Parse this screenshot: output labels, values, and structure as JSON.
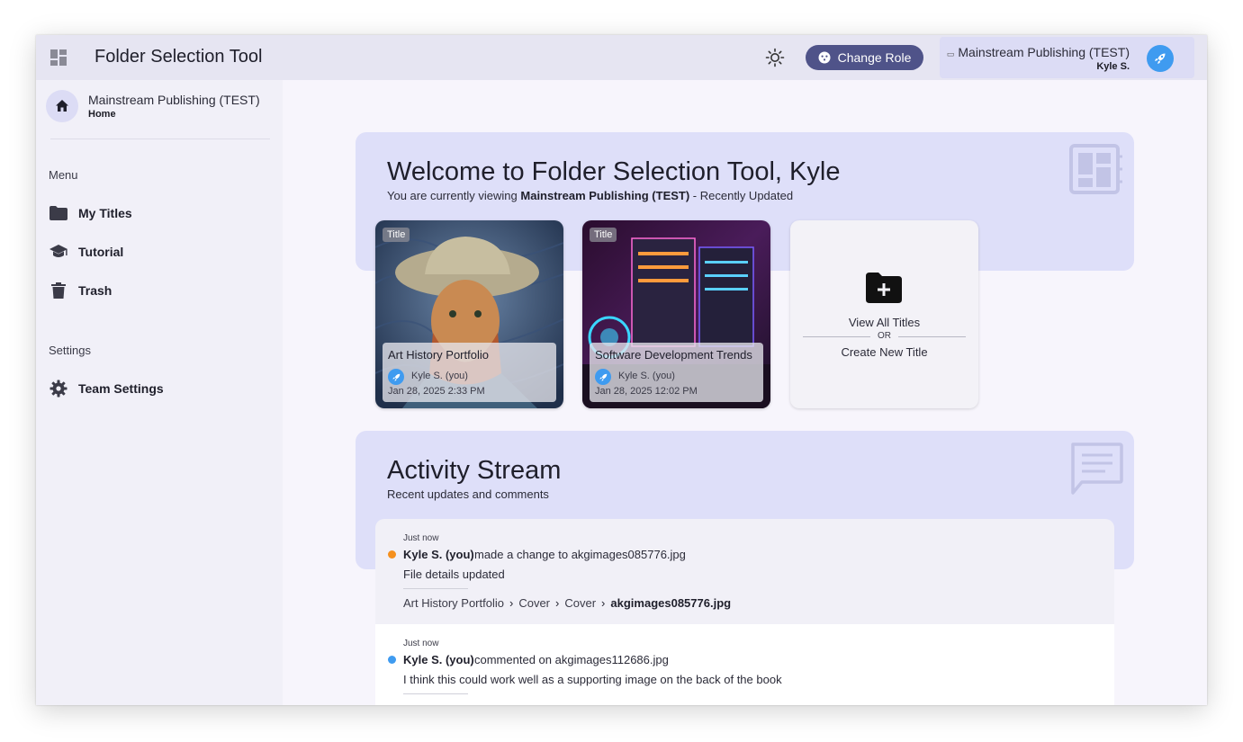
{
  "header": {
    "app_title": "Folder Selection Tool",
    "theme_icon": "sun-icon",
    "change_role_label": "Change Role",
    "account": {
      "org": "Mainstream Publishing (TEST)",
      "user": "Kyle S."
    }
  },
  "sidebar": {
    "org": "Mainstream Publishing (TEST)",
    "home_label": "Home",
    "menu_label": "Menu",
    "menu_items": [
      {
        "label": "My Titles",
        "icon": "folder-icon"
      },
      {
        "label": "Tutorial",
        "icon": "graduation-cap-icon"
      },
      {
        "label": "Trash",
        "icon": "trash-icon"
      }
    ],
    "settings_label": "Settings",
    "settings_items": [
      {
        "label": "Team Settings",
        "icon": "gear-icon"
      }
    ]
  },
  "welcome": {
    "title": "Welcome to Folder Selection Tool, Kyle",
    "subtitle_prefix": "You are currently viewing ",
    "subtitle_org": "Mainstream Publishing (TEST)",
    "subtitle_suffix": " - Recently Updated",
    "cards": [
      {
        "tag": "Title",
        "name": "Art History Portfolio",
        "user": "Kyle S. (you)",
        "date": "Jan 28, 2025 2:33 PM"
      },
      {
        "tag": "Title",
        "name": "Software Development Trends",
        "user": "Kyle S. (you)",
        "date": "Jan 28, 2025 12:02 PM"
      }
    ],
    "new_card": {
      "view_all": "View All Titles",
      "or": "OR",
      "create_new": "Create New Title"
    }
  },
  "activity": {
    "title": "Activity Stream",
    "subtitle": "Recent updates and comments",
    "items": [
      {
        "when": "Just now",
        "who": "Kyle S. (you)",
        "action": "made a change to akgimages085776.jpg",
        "detail": "File details updated",
        "crumbs": [
          "Art History Portfolio",
          "Cover",
          "Cover"
        ],
        "crumb_last": "akgimages085776.jpg",
        "dot_color": "#f5901e"
      },
      {
        "when": "Just now",
        "who": "Kyle S. (you)",
        "action": "commented on akgimages112686.jpg",
        "detail": "I think this could work well as a supporting image on the back of the book",
        "dot_color": "#3f9bf0"
      }
    ]
  },
  "colors": {
    "accent": "#4f5389",
    "panel": "#dedff9",
    "avatar": "#3f9bf0"
  }
}
